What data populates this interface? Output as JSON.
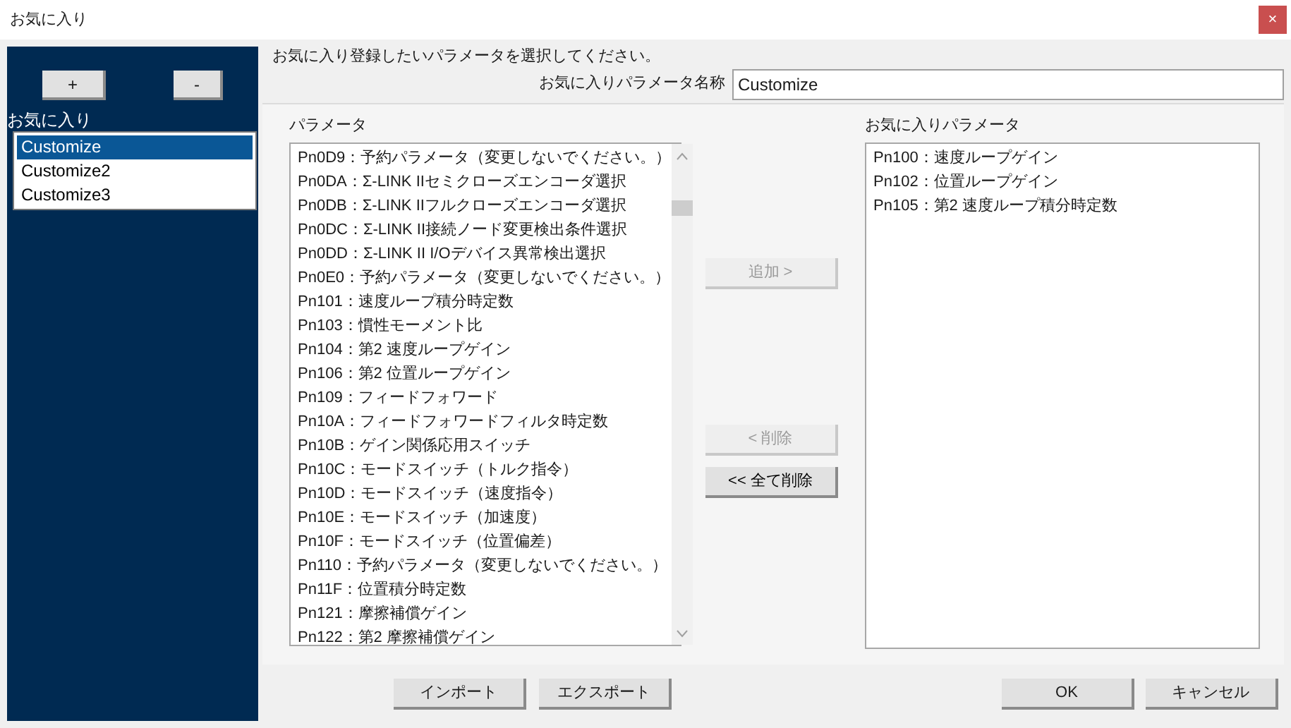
{
  "window": {
    "title": "お気に入り",
    "close": "×"
  },
  "favorites": {
    "add": "+",
    "remove": "-",
    "label": "お気に入り",
    "items": [
      {
        "label": "Customize",
        "selected": true
      },
      {
        "label": "Customize2",
        "selected": false
      },
      {
        "label": "Customize3",
        "selected": false
      }
    ]
  },
  "instruction": "お気に入り登録したいパラメータを選択してください。",
  "name_field": {
    "label": "お気に入りパラメータ名称",
    "value": "Customize"
  },
  "parameters": {
    "label": "パラメータ",
    "items": [
      "Pn0D9：予約パラメータ（変更しないでください。）",
      "Pn0DA：Σ-LINK IIセミクローズエンコーダ選択",
      "Pn0DB：Σ-LINK IIフルクローズエンコーダ選択",
      "Pn0DC：Σ-LINK II接続ノード変更検出条件選択",
      "Pn0DD：Σ-LINK II I/Oデバイス異常検出選択",
      "Pn0E0：予約パラメータ（変更しないでください。）",
      "Pn101：速度ループ積分時定数",
      "Pn103：慣性モーメント比",
      "Pn104：第2 速度ループゲイン",
      "Pn106：第2 位置ループゲイン",
      "Pn109：フィードフォワード",
      "Pn10A：フィードフォワードフィルタ時定数",
      "Pn10B：ゲイン関係応用スイッチ",
      "Pn10C：モードスイッチ（トルク指令）",
      "Pn10D：モードスイッチ（速度指令）",
      "Pn10E：モードスイッチ（加速度）",
      "Pn10F：モードスイッチ（位置偏差）",
      "Pn110：予約パラメータ（変更しないでください。）",
      "Pn11F：位置積分時定数",
      "Pn121：摩擦補償ゲイン",
      "Pn122：第2 摩擦補償ゲイン"
    ]
  },
  "move_buttons": [
    {
      "label": "追加 >",
      "disabled": true
    },
    {
      "label": "< 削除",
      "disabled": true
    },
    {
      "label": "<< 全て削除",
      "disabled": false
    }
  ],
  "favorite_parameters": {
    "label": "お気に入りパラメータ",
    "items": [
      "Pn100：速度ループゲイン",
      "Pn102：位置ループゲイン",
      "Pn105：第2 速度ループ積分時定数"
    ]
  },
  "footer": {
    "left": [
      "インポート",
      "エクスポート"
    ],
    "right": [
      "OK",
      "キャンセル"
    ]
  }
}
